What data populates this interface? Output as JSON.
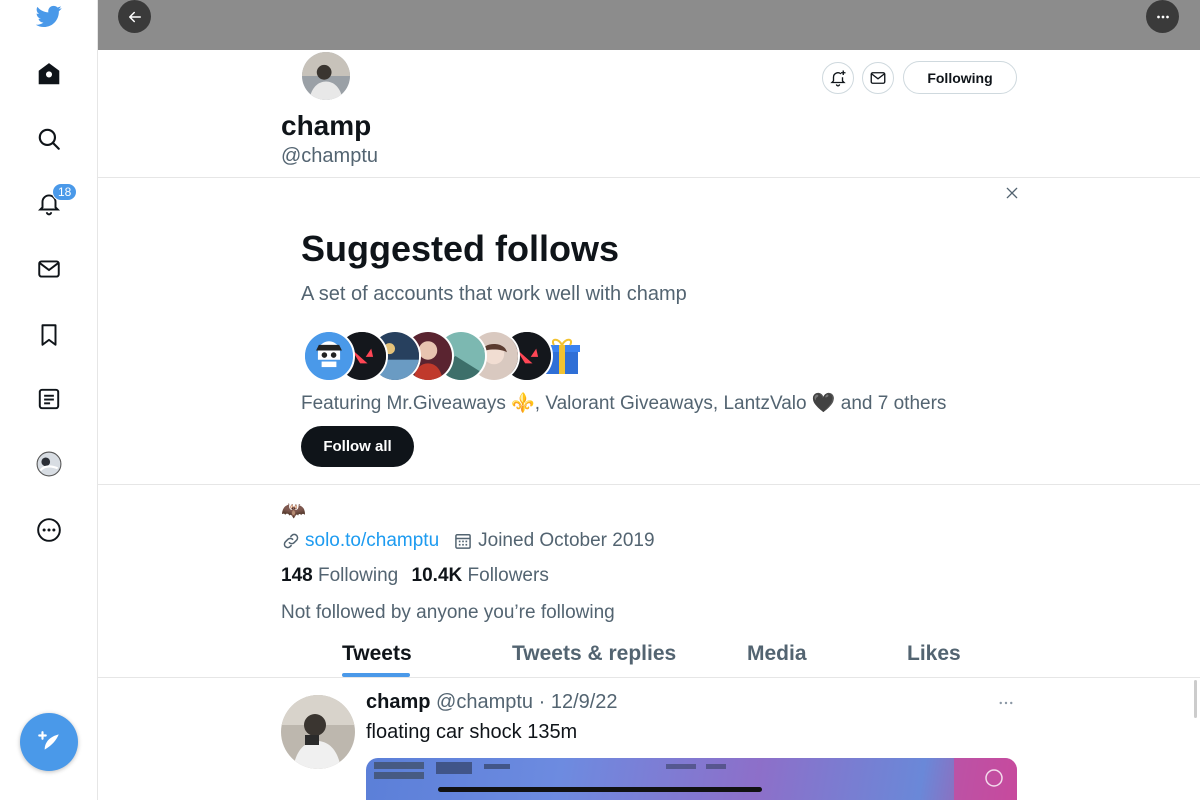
{
  "sidebar": {
    "notification_badge": "18",
    "items": [
      "twitter-logo",
      "home",
      "explore",
      "notifications",
      "messages",
      "bookmarks",
      "lists",
      "profile",
      "more"
    ]
  },
  "profile": {
    "name": "champ",
    "handle": "@champtu",
    "following_button": "Following",
    "bio_emoji": "🦇",
    "website": "solo.to/champtu",
    "joined": "Joined October 2019",
    "following_count": "148",
    "following_label": "Following",
    "followers_count": "10.4K",
    "followers_label": "Followers",
    "not_followed_text": "Not followed by anyone you’re following"
  },
  "suggested": {
    "title": "Suggested follows",
    "subtitle": "A set of accounts that work well with champ",
    "featuring": "Featuring Mr.Giveaways ⚜️, Valorant Giveaways, LantzValo 🖤 and 7 others",
    "follow_all": "Follow all"
  },
  "tabs": [
    "Tweets",
    "Tweets & replies",
    "Media",
    "Likes"
  ],
  "tweet": {
    "name": "champ",
    "handle": "@champtu",
    "date": "12/9/22",
    "text": "floating car shock 135m"
  },
  "colors": {
    "accent": "#4a99e9",
    "text": "#0f1419",
    "secondary": "#536471"
  }
}
